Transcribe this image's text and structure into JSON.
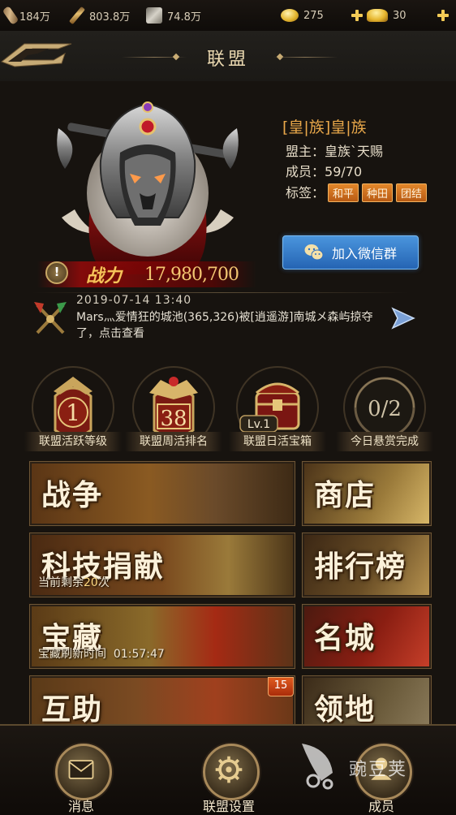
{
  "resources": {
    "wood": "184万",
    "weapons": "803.8万",
    "cloth": "74.8万",
    "coins": "275",
    "gold": "30"
  },
  "header": {
    "title": "联盟"
  },
  "guild": {
    "name": "[皇|族]皇|族",
    "leader_label": "盟主：",
    "leader": "皇族`天赐",
    "members_label": "成员：",
    "members": "59/70",
    "tags_label": "标签：",
    "tags": [
      "和平",
      "种田",
      "团结"
    ],
    "wechat_button": "加入微信群",
    "power_label": "战力",
    "power_value": "17,980,700"
  },
  "news": {
    "date": "2019-07-14  13:40",
    "text": "Mars灬爱情狂的城池(365,326)被[逍遥游]南城メ森屿掠夺了，点击查看"
  },
  "stats": [
    {
      "value": "1",
      "label": "联盟活跃等级"
    },
    {
      "value": "38",
      "label": "联盟周活排名"
    },
    {
      "value": "Lv.1",
      "label": "联盟日活宝箱"
    },
    {
      "value": "0/2",
      "label": "今日悬赏完成"
    }
  ],
  "menu": {
    "war": {
      "title": "战争"
    },
    "shop": {
      "title": "商店"
    },
    "tech": {
      "title": "科技捐献",
      "sub_prefix": "当前剩余",
      "sub_value": "20",
      "sub_suffix": "次"
    },
    "rank": {
      "title": "排行榜"
    },
    "treasure": {
      "title": "宝藏",
      "sub_label": "宝藏刷新时间",
      "sub_value": "01:57:47"
    },
    "city": {
      "title": "名城"
    },
    "help": {
      "title": "互助",
      "badge": "15"
    },
    "territory": {
      "title": "领地"
    }
  },
  "bottom_nav": {
    "messages": "消息",
    "settings": "联盟设置",
    "members": "成员"
  },
  "watermark": "豌豆荚",
  "colors": {
    "accent_gold": "#f3cb56",
    "tag_orange": "#d9741f",
    "wechat_blue": "#2f73c4",
    "guild_name": "#e9a84a"
  }
}
